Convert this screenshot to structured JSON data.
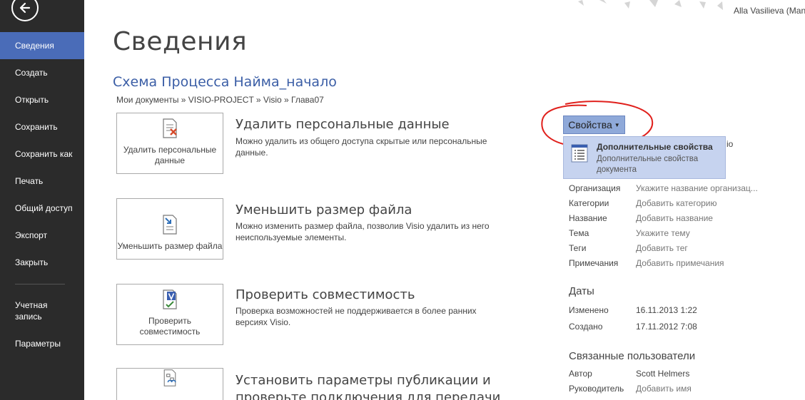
{
  "sidebar": {
    "items": [
      {
        "label": "Сведения"
      },
      {
        "label": "Создать"
      },
      {
        "label": "Открыть"
      },
      {
        "label": "Сохранить"
      },
      {
        "label": "Сохранить как"
      },
      {
        "label": "Печать"
      },
      {
        "label": "Общий доступ"
      },
      {
        "label": "Экспорт"
      },
      {
        "label": "Закрыть"
      },
      {
        "label": "Учетная запись"
      },
      {
        "label": "Параметры"
      }
    ]
  },
  "header": {
    "user": "Alla Vasilieva (Man"
  },
  "main": {
    "title": "Сведения",
    "doc_title": "Схема Процесса Найма_начало",
    "breadcrumb": "Мои документы » VISIO-PROJECT » Visio » Глава07",
    "sections": [
      {
        "button": "Удалить персональные данные",
        "heading": "Удалить персональные данные",
        "desc": "Можно удалить из общего доступа скрытые или персональные данные."
      },
      {
        "button": "Уменьшить размер файла",
        "heading": "Уменьшить размер файла",
        "desc": "Можно изменить размер файла, позволив Visio удалить из него неиспользуемые элементы."
      },
      {
        "button": "Проверить совместимость",
        "heading": "Проверить совместимость",
        "desc": "Проверка возможностей не поддерживается в более ранних версиях Visio."
      },
      {
        "button": "",
        "heading": "Установить параметры публикации и проверьте подключения для передачи",
        "desc": ""
      }
    ]
  },
  "panel": {
    "props_button": "Свойства",
    "dropdown": {
      "title": "Дополнительные свойства",
      "desc": "Дополнительные свойства документа",
      "tail": "io"
    },
    "properties": [
      {
        "label": "Организация",
        "value": "Укажите название организац..."
      },
      {
        "label": "Категории",
        "value": "Добавить категорию"
      },
      {
        "label": "Название",
        "value": "Добавить название"
      },
      {
        "label": "Тема",
        "value": "Укажите тему"
      },
      {
        "label": "Теги",
        "value": "Добавить тег"
      },
      {
        "label": "Примечания",
        "value": "Добавить примечания"
      }
    ],
    "dates_head": "Даты",
    "dates": [
      {
        "label": "Изменено",
        "value": "16.11.2013 1:22"
      },
      {
        "label": "Создано",
        "value": "17.11.2012 7:08"
      }
    ],
    "users_head": "Связанные пользователи",
    "users": [
      {
        "label": "Автор",
        "value": "Scott Helmers"
      },
      {
        "label": "Руководитель",
        "value": "Добавить имя"
      }
    ]
  },
  "colors": {
    "sidebar_bg": "#2b2b2b",
    "active": "#4a6cb8",
    "accent": "#3b5ea6",
    "annotation": "#e0201c"
  }
}
